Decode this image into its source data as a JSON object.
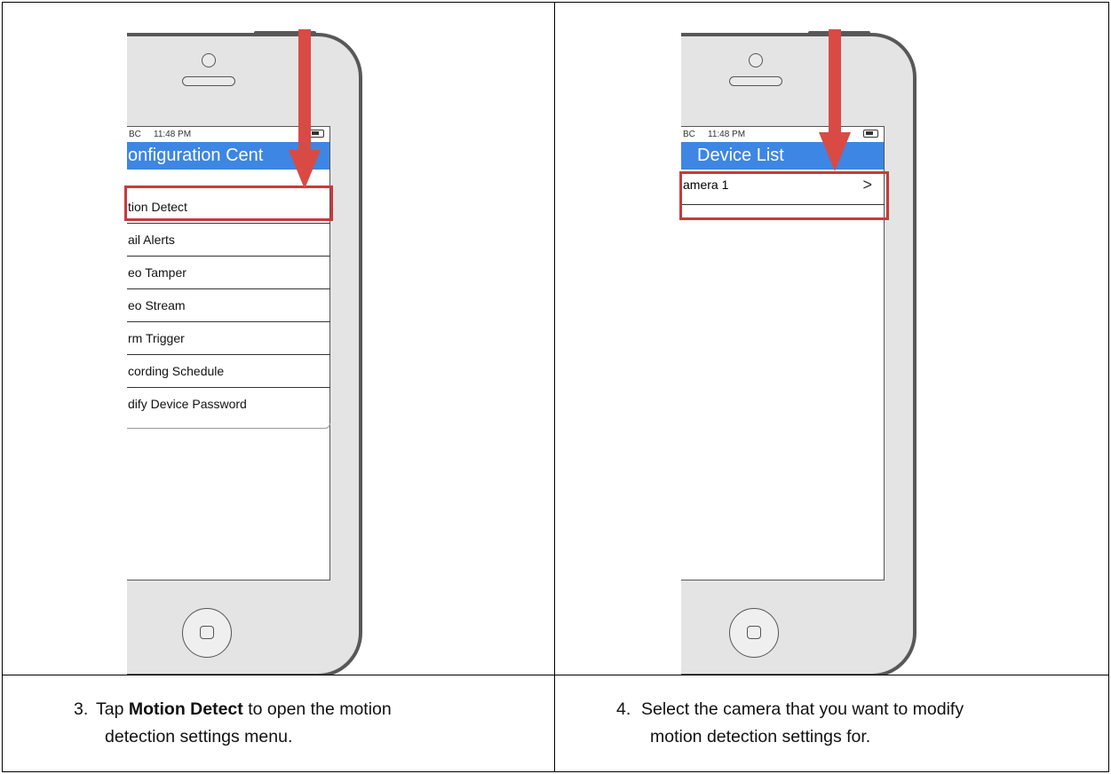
{
  "left_step": {
    "status": {
      "carrier": "BC",
      "time": "11:48 PM"
    },
    "screen_title": "onfiguration Cent",
    "menu_items": [
      "tion Detect",
      "ail Alerts",
      "eo Tamper",
      "eo Stream",
      "rm Trigger",
      "cording Schedule",
      "dify Device Password"
    ],
    "caption_number": "3.",
    "caption_pre": "Tap ",
    "caption_bold": "Motion Detect",
    "caption_post": " to open the motion",
    "caption_line2": "detection settings menu."
  },
  "right_step": {
    "status": {
      "carrier": "BC",
      "time": "11:48 PM"
    },
    "screen_title": "Device List",
    "device_row_label": "amera 1",
    "device_row_chevron": ">",
    "caption_number": "4.",
    "caption_line1": "Select the camera that you want to modify",
    "caption_line2": "motion detection settings for."
  },
  "colors": {
    "arrow": "#d94a45",
    "highlight": "#c83a3a",
    "title_bar": "#3d86e3",
    "phone_body": "#e4e4e4",
    "phone_outline": "#585858"
  }
}
